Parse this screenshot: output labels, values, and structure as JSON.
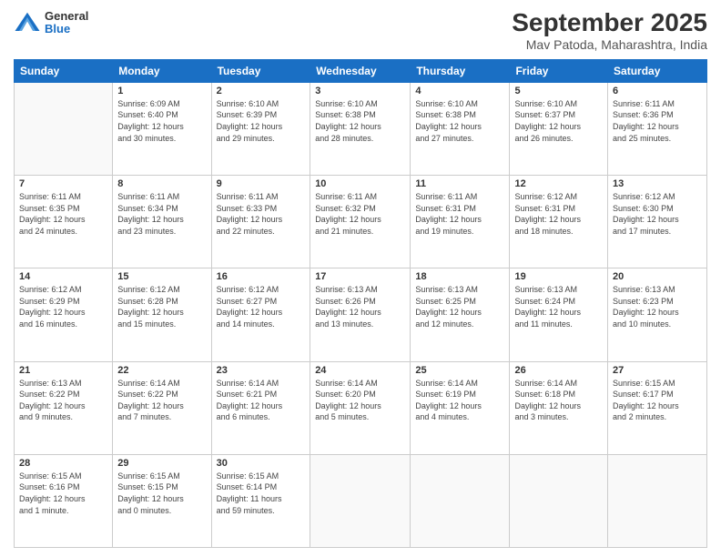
{
  "header": {
    "logo_general": "General",
    "logo_blue": "Blue",
    "title": "September 2025",
    "location": "Mav Patoda, Maharashtra, India"
  },
  "days_of_week": [
    "Sunday",
    "Monday",
    "Tuesday",
    "Wednesday",
    "Thursday",
    "Friday",
    "Saturday"
  ],
  "weeks": [
    [
      {
        "day": "",
        "info": ""
      },
      {
        "day": "1",
        "info": "Sunrise: 6:09 AM\nSunset: 6:40 PM\nDaylight: 12 hours\nand 30 minutes."
      },
      {
        "day": "2",
        "info": "Sunrise: 6:10 AM\nSunset: 6:39 PM\nDaylight: 12 hours\nand 29 minutes."
      },
      {
        "day": "3",
        "info": "Sunrise: 6:10 AM\nSunset: 6:38 PM\nDaylight: 12 hours\nand 28 minutes."
      },
      {
        "day": "4",
        "info": "Sunrise: 6:10 AM\nSunset: 6:38 PM\nDaylight: 12 hours\nand 27 minutes."
      },
      {
        "day": "5",
        "info": "Sunrise: 6:10 AM\nSunset: 6:37 PM\nDaylight: 12 hours\nand 26 minutes."
      },
      {
        "day": "6",
        "info": "Sunrise: 6:11 AM\nSunset: 6:36 PM\nDaylight: 12 hours\nand 25 minutes."
      }
    ],
    [
      {
        "day": "7",
        "info": "Sunrise: 6:11 AM\nSunset: 6:35 PM\nDaylight: 12 hours\nand 24 minutes."
      },
      {
        "day": "8",
        "info": "Sunrise: 6:11 AM\nSunset: 6:34 PM\nDaylight: 12 hours\nand 23 minutes."
      },
      {
        "day": "9",
        "info": "Sunrise: 6:11 AM\nSunset: 6:33 PM\nDaylight: 12 hours\nand 22 minutes."
      },
      {
        "day": "10",
        "info": "Sunrise: 6:11 AM\nSunset: 6:32 PM\nDaylight: 12 hours\nand 21 minutes."
      },
      {
        "day": "11",
        "info": "Sunrise: 6:11 AM\nSunset: 6:31 PM\nDaylight: 12 hours\nand 19 minutes."
      },
      {
        "day": "12",
        "info": "Sunrise: 6:12 AM\nSunset: 6:31 PM\nDaylight: 12 hours\nand 18 minutes."
      },
      {
        "day": "13",
        "info": "Sunrise: 6:12 AM\nSunset: 6:30 PM\nDaylight: 12 hours\nand 17 minutes."
      }
    ],
    [
      {
        "day": "14",
        "info": "Sunrise: 6:12 AM\nSunset: 6:29 PM\nDaylight: 12 hours\nand 16 minutes."
      },
      {
        "day": "15",
        "info": "Sunrise: 6:12 AM\nSunset: 6:28 PM\nDaylight: 12 hours\nand 15 minutes."
      },
      {
        "day": "16",
        "info": "Sunrise: 6:12 AM\nSunset: 6:27 PM\nDaylight: 12 hours\nand 14 minutes."
      },
      {
        "day": "17",
        "info": "Sunrise: 6:13 AM\nSunset: 6:26 PM\nDaylight: 12 hours\nand 13 minutes."
      },
      {
        "day": "18",
        "info": "Sunrise: 6:13 AM\nSunset: 6:25 PM\nDaylight: 12 hours\nand 12 minutes."
      },
      {
        "day": "19",
        "info": "Sunrise: 6:13 AM\nSunset: 6:24 PM\nDaylight: 12 hours\nand 11 minutes."
      },
      {
        "day": "20",
        "info": "Sunrise: 6:13 AM\nSunset: 6:23 PM\nDaylight: 12 hours\nand 10 minutes."
      }
    ],
    [
      {
        "day": "21",
        "info": "Sunrise: 6:13 AM\nSunset: 6:22 PM\nDaylight: 12 hours\nand 9 minutes."
      },
      {
        "day": "22",
        "info": "Sunrise: 6:14 AM\nSunset: 6:22 PM\nDaylight: 12 hours\nand 7 minutes."
      },
      {
        "day": "23",
        "info": "Sunrise: 6:14 AM\nSunset: 6:21 PM\nDaylight: 12 hours\nand 6 minutes."
      },
      {
        "day": "24",
        "info": "Sunrise: 6:14 AM\nSunset: 6:20 PM\nDaylight: 12 hours\nand 5 minutes."
      },
      {
        "day": "25",
        "info": "Sunrise: 6:14 AM\nSunset: 6:19 PM\nDaylight: 12 hours\nand 4 minutes."
      },
      {
        "day": "26",
        "info": "Sunrise: 6:14 AM\nSunset: 6:18 PM\nDaylight: 12 hours\nand 3 minutes."
      },
      {
        "day": "27",
        "info": "Sunrise: 6:15 AM\nSunset: 6:17 PM\nDaylight: 12 hours\nand 2 minutes."
      }
    ],
    [
      {
        "day": "28",
        "info": "Sunrise: 6:15 AM\nSunset: 6:16 PM\nDaylight: 12 hours\nand 1 minute."
      },
      {
        "day": "29",
        "info": "Sunrise: 6:15 AM\nSunset: 6:15 PM\nDaylight: 12 hours\nand 0 minutes."
      },
      {
        "day": "30",
        "info": "Sunrise: 6:15 AM\nSunset: 6:14 PM\nDaylight: 11 hours\nand 59 minutes."
      },
      {
        "day": "",
        "info": ""
      },
      {
        "day": "",
        "info": ""
      },
      {
        "day": "",
        "info": ""
      },
      {
        "day": "",
        "info": ""
      }
    ]
  ]
}
